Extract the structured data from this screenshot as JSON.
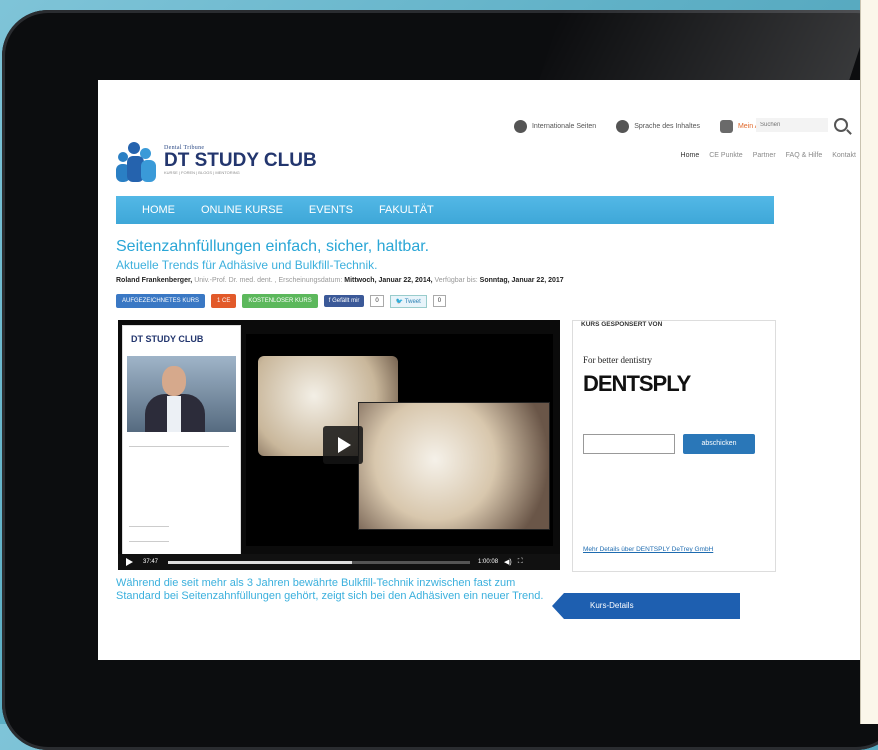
{
  "header": {
    "logo_small": "Dental Tribune",
    "logo_title": "DT STUDY CLUB",
    "logo_sub": "KURSE | FOREN | BLOGS | MENTORING",
    "top_links": [
      "Internationale Seiten",
      "Sprache des Inhaltes",
      "Mein Account"
    ],
    "search_placeholder": "Suchen",
    "subnav": [
      "Home",
      "CE Punkte",
      "Partner",
      "FAQ & Hilfe",
      "Kontakt"
    ]
  },
  "mainnav": [
    "HOME",
    "ONLINE KURSE",
    "EVENTS",
    "FAKULTÄT"
  ],
  "course": {
    "title": "Seitenzahnfüllungen einfach, sicher, haltbar.",
    "subtitle": "Aktuelle Trends für Adhäsive und Bulkfill-Technik.",
    "author": "Roland Frankenberger,",
    "author_title": " Univ.-Prof. Dr. med. dent. , Erscheinungsdatum:",
    "date": " Mittwoch, Januar 22, 2014,",
    "avail_label": " Verfügbar bis:",
    "avail_date": " Sonntag, Januar 22, 2017",
    "badges": [
      "AUFGEZEICHNETES KURS",
      "1 CE",
      "KOSTENLOSER KURS"
    ],
    "like_label": "Gefällt mir",
    "like_count": "0",
    "tweet_label": "Tweet",
    "tweet_count": "0",
    "description": "Während die seit mehr als 3 Jahren bewährte Bulkfill-Technik inzwischen fast zum Standard bei Seitenzahnfüllungen gehört, zeigt sich bei den Adhäsiven ein neuer Trend.",
    "details_button": "Kurs-Details"
  },
  "video": {
    "logo": "DT STUDY CLUB",
    "current_time": "37:47",
    "duration": "1:00:08",
    "progress": 0.61
  },
  "sponsor": {
    "heading": "KURS GESPONSERT VON",
    "tagline": "For better dentistry",
    "brand": "DENTSPLY",
    "button": "abschicken",
    "link": "Mehr Details über DENTSPLY DeTrey GmbH"
  },
  "colors": {
    "badge_blue": "#3a78c4",
    "badge_red": "#e25a2a",
    "badge_green": "#5cb85c",
    "accent": "#2aa6d6"
  }
}
